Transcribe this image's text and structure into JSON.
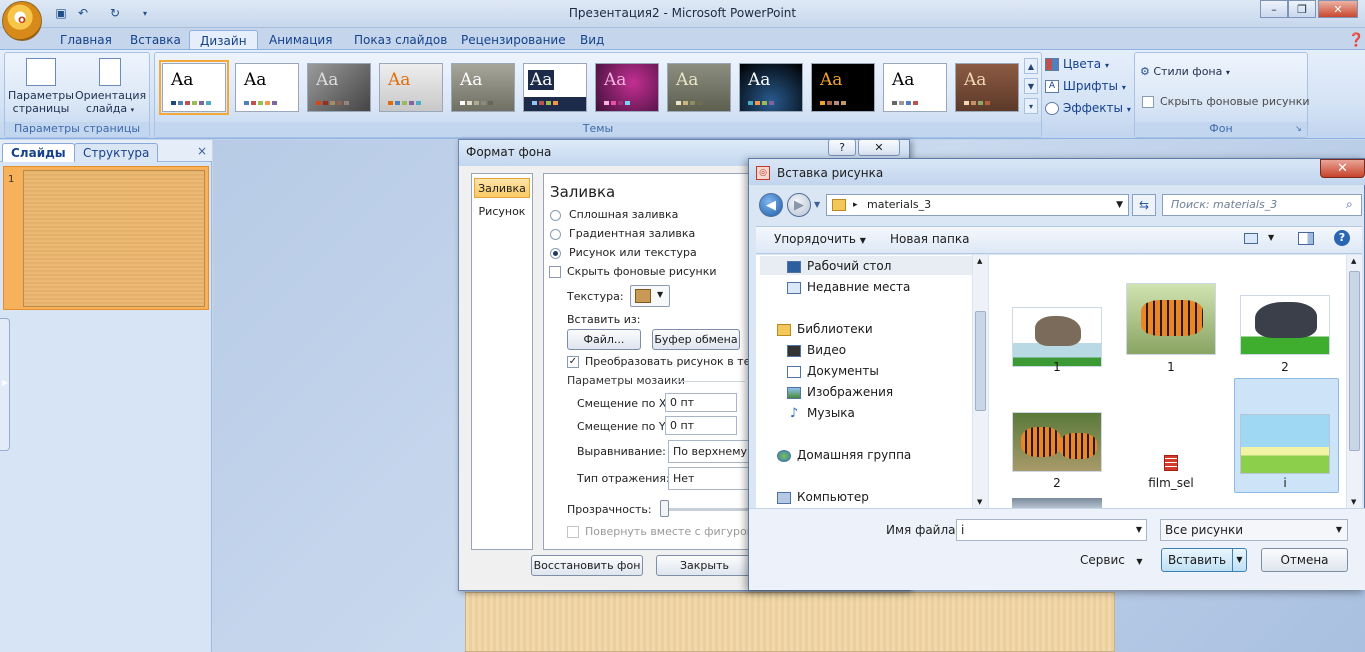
{
  "window": {
    "title": "Презентация2 - Microsoft PowerPoint",
    "office_button": "O",
    "qat_icons": [
      "save-icon",
      "undo-icon",
      "redo-icon",
      "customize-qat-icon"
    ]
  },
  "tabs": [
    {
      "label": "Главная"
    },
    {
      "label": "Вставка"
    },
    {
      "label": "Дизайн"
    },
    {
      "label": "Анимация"
    },
    {
      "label": "Показ слайдов"
    },
    {
      "label": "Рецензирование"
    },
    {
      "label": "Вид"
    }
  ],
  "ribbon": {
    "page_setup": {
      "params_label": "Параметры страницы",
      "orientation_label": "Ориентация слайда",
      "group_label": "Параметры страницы"
    },
    "themes": {
      "group_label": "Темы",
      "sample_text": "Aa"
    },
    "theme_options": {
      "colors": "Цвета",
      "fonts": "Шрифты",
      "effects": "Эффекты"
    },
    "background": {
      "styles": "Стили фона",
      "hide": "Скрыть фоновые рисунки",
      "group_label": "Фон"
    }
  },
  "left_pane": {
    "tabs": [
      "Слайды",
      "Структура"
    ],
    "close": "×",
    "slide_number": "1"
  },
  "format_dialog": {
    "title": "Формат фона",
    "help": "?",
    "close": "✕",
    "nav": [
      "Заливка",
      "Рисунок"
    ],
    "heading": "Заливка",
    "options": [
      {
        "label": "Сплошная заливка",
        "selected": false
      },
      {
        "label": "Градиентная заливка",
        "selected": false
      },
      {
        "label": "Рисунок или текстура",
        "selected": true
      }
    ],
    "hide_bg": "Скрыть фоновые рисунки",
    "texture_label": "Текстура:",
    "insert_from": "Вставить из:",
    "file_btn": "Файл...",
    "clipboard_btn": "Буфер обмена",
    "tile_check": "Преобразовать рисунок в текстуру",
    "tile_params": "Параметры мозаики",
    "offset_x_label": "Смещение по X:",
    "offset_x": "0 пт",
    "offset_y_label": "Смещение по Y:",
    "offset_y": "0 пт",
    "align_label": "Выравнивание:",
    "align_value": "По верхнему краю",
    "mirror_label": "Тип отражения:",
    "mirror_value": "Нет",
    "transparency_label": "Прозрачность:",
    "rotate_label": "Повернуть вместе с фигурой",
    "reset_btn": "Восстановить фон",
    "close_btn": "Закрыть"
  },
  "insert_dialog": {
    "title": "Вставка рисунка",
    "close": "✕",
    "address": "materials_3",
    "search_placeholder": "Поиск: materials_3",
    "organize": "Упорядочить",
    "new_folder": "Новая папка",
    "tree": [
      {
        "label": "Рабочий стол",
        "icon": "desktop-icon"
      },
      {
        "label": "Недавние места",
        "icon": "recent-places-icon"
      },
      {
        "label": "Библиотеки",
        "icon": "libraries-icon"
      },
      {
        "label": "Видео",
        "icon": "video-icon"
      },
      {
        "label": "Документы",
        "icon": "documents-icon"
      },
      {
        "label": "Изображения",
        "icon": "pictures-icon"
      },
      {
        "label": "Музыка",
        "icon": "music-icon"
      },
      {
        "label": "Домашняя группа",
        "icon": "homegroup-icon"
      },
      {
        "label": "Компьютер",
        "icon": "computer-icon"
      }
    ],
    "files": [
      {
        "label": "1",
        "kind": "elephant"
      },
      {
        "label": "1",
        "kind": "tiger"
      },
      {
        "label": "2",
        "kind": "rhino"
      },
      {
        "label": "2",
        "kind": "tigers"
      },
      {
        "label": "film_sel",
        "kind": "film"
      },
      {
        "label": "i",
        "kind": "meadow",
        "selected": true
      }
    ],
    "filename_label": "Имя файла:",
    "filename_value": "i",
    "filter": "Все рисунки",
    "service": "Сервис",
    "insert_btn": "Вставить",
    "cancel_btn": "Отмена"
  }
}
